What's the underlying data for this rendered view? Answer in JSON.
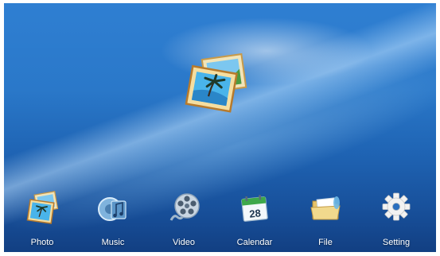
{
  "dock": {
    "items": [
      {
        "label": "Photo",
        "icon": "photo-icon"
      },
      {
        "label": "Music",
        "icon": "music-icon"
      },
      {
        "label": "Video",
        "icon": "video-reel-icon"
      },
      {
        "label": "Calendar",
        "icon": "calendar-icon",
        "date": "28"
      },
      {
        "label": "File",
        "icon": "folder-icon"
      },
      {
        "label": "Setting",
        "icon": "gear-icon"
      }
    ]
  },
  "colors": {
    "background_top": "#2f7fd2",
    "background_bottom": "#123f82",
    "label": "#ffffff"
  }
}
